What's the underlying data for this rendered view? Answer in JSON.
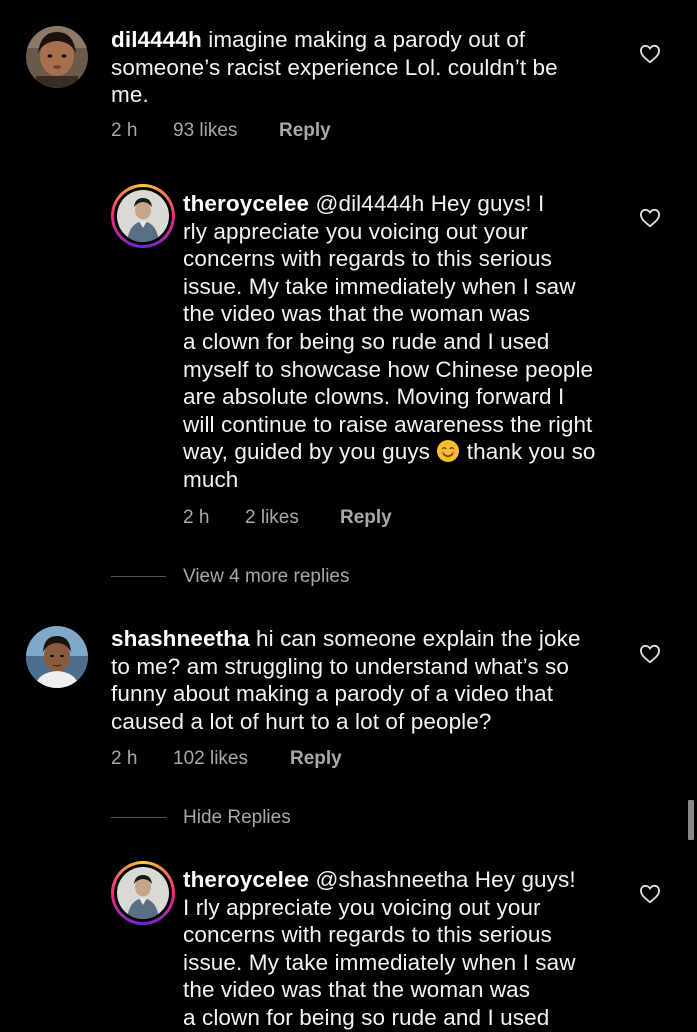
{
  "colors": {
    "background": "#000000",
    "text": "#f2f2f2",
    "meta": "#a8a8a8",
    "story_ring": [
      "#f9ce34",
      "#ee2a7b",
      "#6228d7"
    ]
  },
  "comments": [
    {
      "username": "dil4444h",
      "lines": [
        "imagine making a parody out of",
        "someone’s racist experience Lol. couldn’t be",
        "me."
      ],
      "time": "2 h",
      "likes": "93 likes",
      "reply_label": "Reply",
      "like_icon": "heart-outline-icon"
    },
    {
      "username": "theroycelee",
      "lines": [
        "@dil4444h Hey guys! I",
        "rly appreciate you voicing out your",
        "concerns with regards to this serious",
        "issue. My take immediately when I saw",
        "the video was that the woman was",
        "a clown for being so rude and I used",
        "myself to showcase how Chinese people",
        "are absolute clowns. Moving forward I",
        "will continue to raise awareness the right",
        "way, guided by you guys",
        "thank you so",
        "much"
      ],
      "emoji": "smiling-face-emoji",
      "time": "2 h",
      "likes": "2 likes",
      "reply_label": "Reply",
      "like_icon": "heart-outline-icon"
    },
    {
      "username": "shashneetha",
      "lines": [
        "hi can someone explain the joke",
        "to me? am struggling to understand what’s so",
        "funny about making a parody of a video that",
        "caused a lot of hurt to a lot of people?"
      ],
      "time": "2 h",
      "likes": "102 likes",
      "reply_label": "Reply",
      "like_icon": "heart-outline-icon"
    },
    {
      "username": "theroycelee",
      "lines": [
        "@shashneetha Hey guys!",
        "I rly appreciate you voicing out your",
        "concerns with regards to this serious",
        "issue. My take immediately when I saw",
        "the video was that the woman was",
        "a clown for being so rude and I used"
      ],
      "like_icon": "heart-outline-icon"
    }
  ],
  "threads": {
    "view_more": "View 4 more replies",
    "hide_replies": "Hide Replies"
  }
}
